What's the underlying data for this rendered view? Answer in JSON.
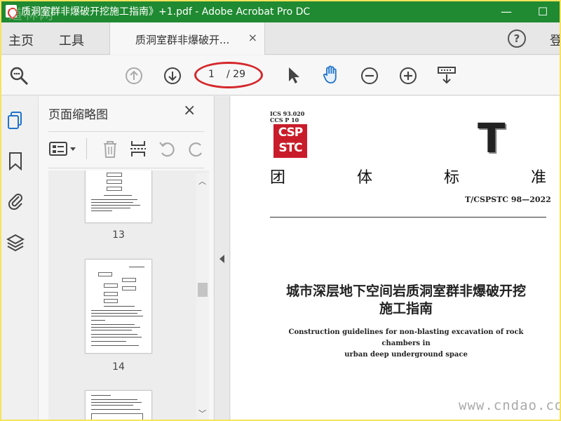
{
  "window": {
    "title": "质洞室群非爆破开挖施工指南》+1.pdf - Adobe Acrobat Pro DC",
    "watermark": "道林网",
    "minimize": "—",
    "maximize": "☐"
  },
  "tabs": {
    "home": "主页",
    "tools": "工具",
    "document": "质洞室群非爆破开...",
    "close": "×",
    "help": "?",
    "login": "登"
  },
  "toolbar": {
    "current_page": "1",
    "total_pages": "/ 29"
  },
  "thumbnails": {
    "title": "页面缩略图",
    "close": "×",
    "pages": [
      "13",
      "14"
    ]
  },
  "document": {
    "ics": "ICS 93.020",
    "ccs": "CCS P 10",
    "logo_top": "CSP",
    "logo_bottom": "STC",
    "big_letter": "T",
    "std_chars": [
      "团",
      "体",
      "标",
      "准"
    ],
    "std_code": "T/CSPSTC 98—2022",
    "title_line1": "城市深层地下空间岩质洞室群非爆破开挖",
    "title_line2": "施工指南",
    "en_title_line1": "Construction guidelines for non-blasting excavation of rock chambers in",
    "en_title_line2": "urban deep underground space",
    "watermark": "www.cndao.com"
  },
  "colors": {
    "titlebar": "#1f8a31",
    "accent_red": "#d4272b",
    "hand_tool": "#1f73c9",
    "logo_red": "#c91c2a"
  }
}
